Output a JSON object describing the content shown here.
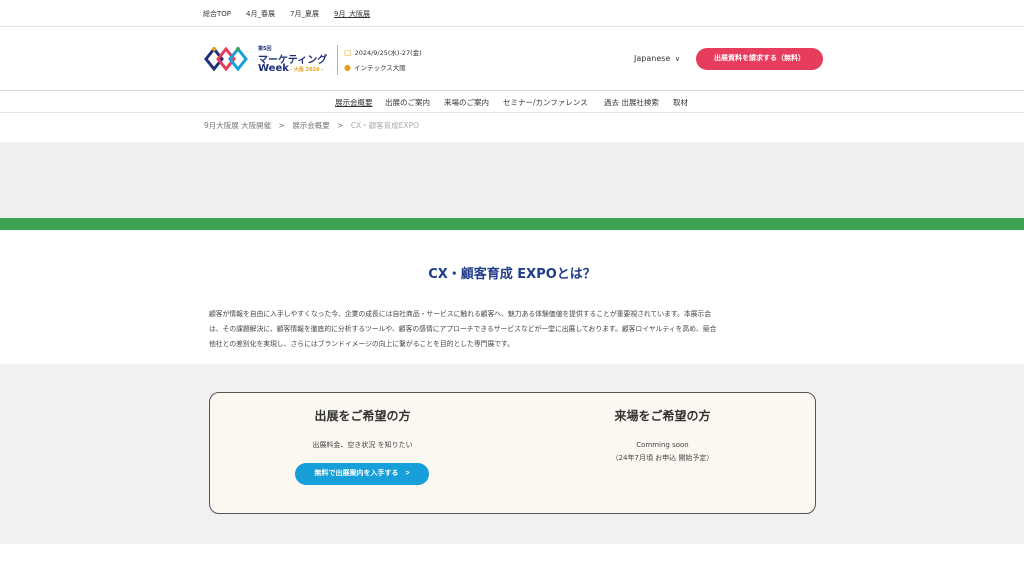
{
  "topbar": {
    "links": [
      {
        "label": "総合TOP",
        "active": false
      },
      {
        "label": "4月_春展",
        "active": false
      },
      {
        "label": "7月_夏展",
        "active": false
      },
      {
        "label": "9月_大阪展",
        "active": true
      }
    ]
  },
  "header": {
    "logo": {
      "edition": "第5回",
      "name_line1": "マーケティング",
      "name_line2": "Week",
      "city": "- 大阪 2024 -"
    },
    "event_date": "2024/9/25(水)-27(金)",
    "event_place": "インテックス大阪",
    "language": "Japanese",
    "cta_label": "出展資料を請求する（無料）",
    "colors": {
      "cta": "#e73c5e",
      "brand": "#1f2f7a",
      "accent": "#e8a21a"
    }
  },
  "nav": {
    "items": [
      {
        "label": "展示会概要",
        "active": true
      },
      {
        "label": "出展のご案内",
        "active": false
      },
      {
        "label": "来場のご案内",
        "active": false
      },
      {
        "label": "セミナー/カンファレンス",
        "active": false
      },
      {
        "label": "過去 出展社検索",
        "active": false
      },
      {
        "label": "取材",
        "active": false
      }
    ]
  },
  "breadcrumb": {
    "items": [
      "9月大阪展 大阪開催",
      "展示会概要",
      "CX・顧客育成EXPO"
    ],
    "separator": ">"
  },
  "section": {
    "title": "CX・顧客育成 EXPOとは？",
    "lines": [
      "顧客が情報を自由に入手しやすくなった今、企業の成長には自社商品・サービスに触れる顧客へ、魅力ある体験価値を提供することが重要視されています。本展示会",
      "は、その課題解決に、顧客情報を徹底的に分析するツールや、顧客の感情にアプローチできるサービスなどが一堂に出展しております。顧客ロイヤルティを高め、競合",
      "他社との差別化を実現し、さらにはブランドイメージの向上に繋がることを目的とした専門展です。"
    ]
  },
  "exhibit": {
    "title": "出展をご希望の方",
    "subtitle": "出展料金、空き状況 を知りたい",
    "button_label": "無料で出展案内を入手する　>",
    "button_color": "#169fd9"
  },
  "visit": {
    "title": "来場をご希望の方",
    "line1": "Comming soon",
    "line2": "（24年7月頃 お申込 開始予定）"
  },
  "banner": {
    "green": "#3ea452"
  }
}
